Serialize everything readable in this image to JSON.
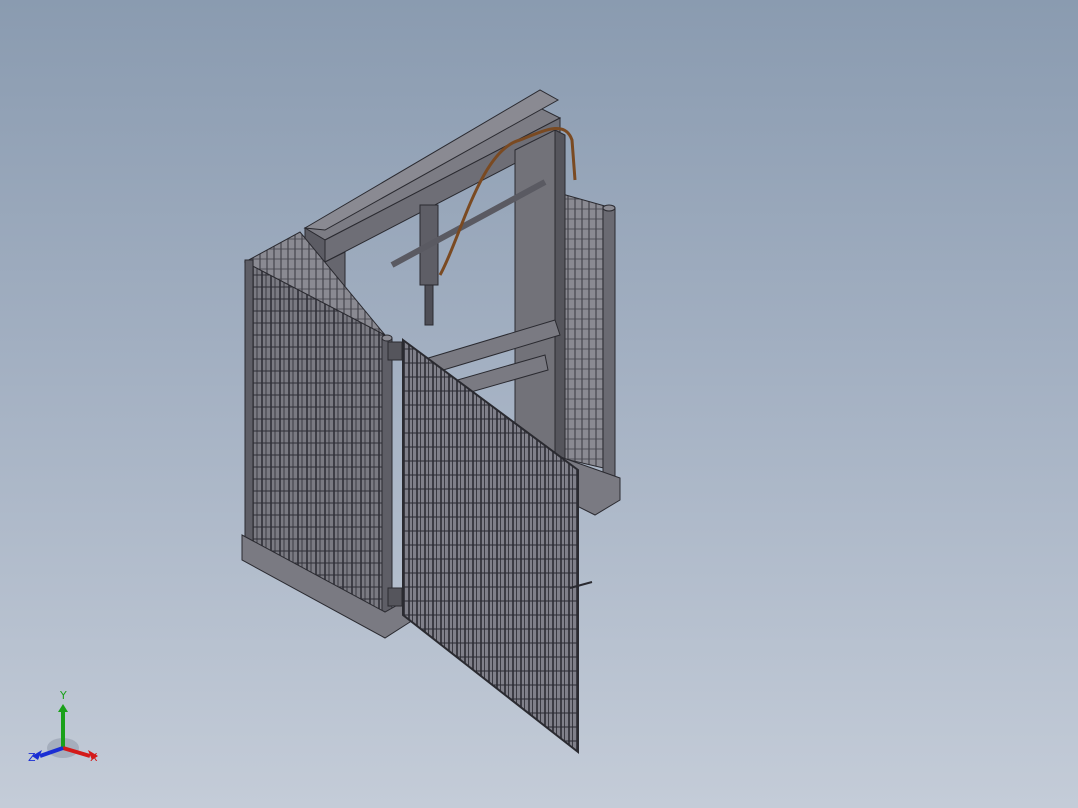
{
  "viewport": {
    "background_top": "#8a9bb0",
    "background_bottom": "#c4ccd8",
    "model_color": "#6b6b72",
    "edge_color": "#2a2a30",
    "hose_color": "#7a4a22"
  },
  "triad": {
    "x_label": "X",
    "y_label": "Y",
    "z_label": "Z",
    "x_color": "#d41a1a",
    "y_color": "#1aa11a",
    "z_color": "#1a2ed4"
  }
}
